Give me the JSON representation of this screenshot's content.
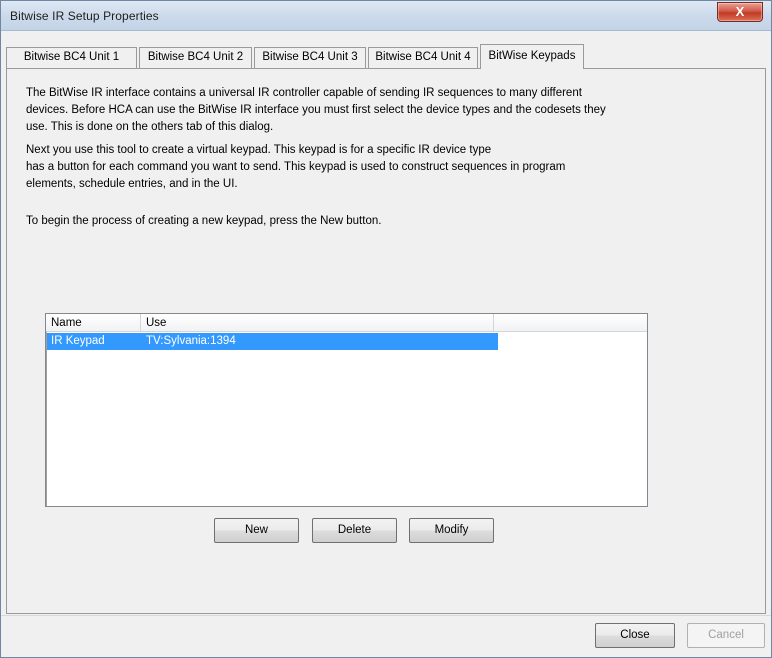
{
  "window": {
    "title": "Bitwise IR Setup Properties",
    "close_glyph": "X"
  },
  "tabs": [
    {
      "label": "Bitwise BC4 Unit 1",
      "active": false
    },
    {
      "label": "Bitwise BC4 Unit 2",
      "active": false
    },
    {
      "label": "Bitwise BC4 Unit 3",
      "active": false
    },
    {
      "label": "Bitwise BC4 Unit 4",
      "active": false
    },
    {
      "label": "BitWise Keypads",
      "active": true
    }
  ],
  "content": {
    "paragraph1_lines": [
      "The BitWise IR interface contains a universal IR controller capable of sending IR sequences to many different",
      "devices.  Before HCA can use the BitWise IR interface you must first select the device types and the codesets they",
      "use.  This is done on the others tab of this dialog."
    ],
    "paragraph2_lines": [
      "Next you use this tool to create a virtual keypad.  This keypad is for a specific IR device type",
      "has a button for each command you want to send.  This keypad is used to construct sequences in program",
      "elements, schedule entries, and in the UI."
    ],
    "paragraph3": "To begin the process of creating a new keypad, press the New button."
  },
  "keypad_list": {
    "columns": [
      "Name",
      "Use"
    ],
    "rows": [
      {
        "name": "IR Keypad",
        "use": "TV:Sylvania:1394",
        "selected": true
      }
    ]
  },
  "actions": {
    "new_label": "New",
    "delete_label": "Delete",
    "modify_label": "Modify"
  },
  "footer": {
    "close_label": "Close",
    "cancel_label": "Cancel"
  },
  "colors": {
    "selection": "#3399ff",
    "titlebar": "#cbd9ea",
    "close_button": "#c13a24"
  }
}
